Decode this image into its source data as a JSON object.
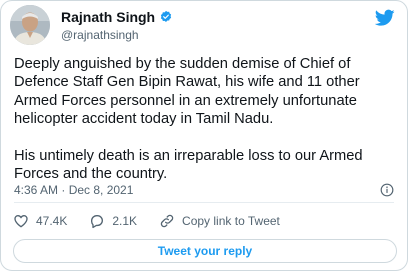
{
  "author": {
    "name": "Rajnath Singh",
    "handle": "@rajnathsingh",
    "avatar_icon": "profile-photo-avatar",
    "verified_icon": "verified-badge-icon"
  },
  "tweet": {
    "paragraphs": [
      "Deeply anguished by the sudden demise of Chief of Defence Staff Gen Bipin Rawat, his wife and 11 other Armed Forces personnel in an extremely unfortunate helicopter accident today in Tamil Nadu.",
      "His untimely death is an irreparable loss to our Armed Forces and the country."
    ],
    "timestamp": "4:36 AM · Dec 8, 2021"
  },
  "actions": {
    "likes": "47.4K",
    "replies": "2.1K",
    "copy_link": "Copy link to Tweet",
    "reply_button": "Tweet your reply"
  },
  "colors": {
    "brand": "#1d9bf0",
    "text": "#0f1419",
    "secondary": "#536471",
    "border": "#cfd9de"
  }
}
